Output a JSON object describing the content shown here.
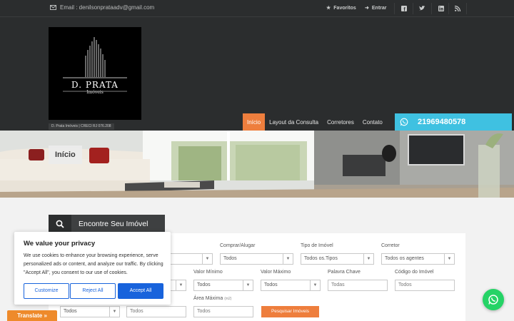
{
  "topbar": {
    "email": "Email : denilsonprataadv@gmail.com",
    "favoritos": "Favoritos",
    "entrar": "Entrar",
    "social_icons": [
      "facebook-icon",
      "twitter-icon",
      "linkedin-icon",
      "rss-icon"
    ]
  },
  "logo": {
    "brand": "D. PRATA",
    "sub": "Imóveis",
    "caption": "D. Prata Imóveis | CRECI RJ 076.208"
  },
  "nav": {
    "items": [
      "Início",
      "Layout da Consulta",
      "Corretores",
      "Contato"
    ],
    "active": "Início",
    "phone": "21969480578"
  },
  "hero": {
    "title": "Início"
  },
  "search": {
    "tab_label": "Encontre Seu Imóvel",
    "fields": {
      "comprar_label": "Comprar/Alugar",
      "comprar_value": "Todos",
      "tipo_label": "Tipo de Imóvel",
      "tipo_value": "Todos os.Tipos",
      "corretor_label": "Corretor",
      "corretor_value": "Todos os agentes",
      "valor_min_label": "Valor Mínimo",
      "valor_min_value": "Todos",
      "valor_max_label": "Valor Máximo",
      "valor_max_value": "Todos",
      "palavra_label": "Palavra Chave",
      "palavra_placeholder": "Todas",
      "codigo_label": "Código do Imóvel",
      "codigo_placeholder": "Todos",
      "area_label": "Área Máxima",
      "area_unit": "(m2)",
      "area_placeholder": "Todos",
      "row3_select_value": "Todos",
      "row3_input_placeholder": "Todos"
    },
    "button": "Pesquisar Imóveis"
  },
  "cookie": {
    "title": "We value your privacy",
    "body": "We use cookies to enhance your browsing experience, serve personalized ads or content, and analyze our traffic. By clicking \"Accept All\", you consent to our use of cookies.",
    "customize": "Customize",
    "reject": "Reject All",
    "accept": "Accept All"
  },
  "translate": "Translate »",
  "colors": {
    "accent_orange": "#ee7e3d",
    "phone_blue": "#3fc1e1",
    "dark_header": "#2b2d2e",
    "cookie_blue": "#1863dc",
    "whatsapp_green": "#25d366"
  }
}
